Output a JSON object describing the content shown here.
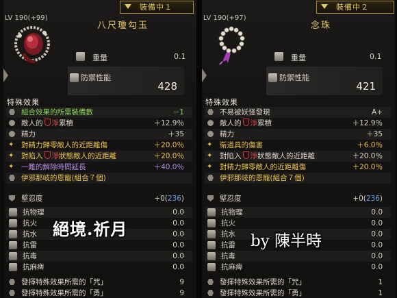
{
  "left": {
    "equip_tab": "裝備中１",
    "level": "LV 190",
    "level_plus": "(+99)",
    "item_name": "八尺瓊勾玉",
    "weight_label": "重量",
    "weight_value": "0.1",
    "defense_label": "防禦性能",
    "defense_value": "428",
    "special_title": "特殊效果",
    "effects": [
      {
        "icon": "hex-icon",
        "pre": "組合效果的所需裝備數",
        "shield": false,
        "post": "",
        "value": "－1",
        "color": "#8cd65b"
      },
      {
        "icon": "dot-icon",
        "pre": "敵人的",
        "shield": true,
        "mid": "淨",
        "post": "累積",
        "value": "＋12.9％",
        "color": "#d9d5cb"
      },
      {
        "icon": "dot-icon",
        "pre": "精力",
        "shield": false,
        "post": "",
        "value": "＋35",
        "color": "#d9d5cb"
      },
      {
        "icon": "star-icon",
        "pre": "對精力歸零敵人的近距離傷",
        "shield": false,
        "post": "",
        "value": "＋20.0％",
        "color": "#e8c24c"
      },
      {
        "icon": "star-icon",
        "pre": "對陷入",
        "shield": true,
        "mid": "淨",
        "post": "狀態敵人的近距離",
        "value": "＋20.0％",
        "color": "#e8c24c"
      },
      {
        "icon": "star-icon",
        "pre": "一難的解除時間延長",
        "shield": false,
        "post": "",
        "value": "＋40.0％",
        "color": "#b48ae0"
      },
      {
        "icon": "hex-icon",
        "pre": "伊邪那岐的恩寵(組合７個)",
        "shield": false,
        "post": "",
        "value": "",
        "color": "#e8c24c"
      }
    ],
    "toughness_label": "堅忍度",
    "toughness_value": "+0(",
    "toughness_value_blue": "236",
    "toughness_close": ")",
    "resistances": [
      {
        "label": "抗物理",
        "value": "0.0"
      },
      {
        "label": "抗火",
        "value": "0.0"
      },
      {
        "label": "抗水",
        "value": "0.0"
      },
      {
        "label": "抗雷",
        "value": "0.0"
      },
      {
        "label": "抗毒",
        "value": "0.0"
      },
      {
        "label": "抗麻痺",
        "value": "0.0"
      }
    ],
    "req1_label": "發揮特殊效果所需的「咒」",
    "req1_value": "9",
    "req2_label": "發揮特殊效果所需的「勇」",
    "req2_value": "9",
    "watermark": "絕境.祈月"
  },
  "right": {
    "equip_tab": "裝備中２",
    "level": "LV 190",
    "level_plus": "(+97)",
    "item_name": "念珠",
    "weight_label": "重量",
    "weight_value": "0.1",
    "defense_label": "防禦性能",
    "defense_value": "421",
    "special_title": "特殊效果",
    "effects": [
      {
        "icon": "hex-icon",
        "pre": "不易被妖怪發現",
        "shield": false,
        "post": "",
        "value": "A+",
        "color": "#d9d5cb"
      },
      {
        "icon": "dot-icon",
        "pre": "敵人的",
        "shield": true,
        "mid": "淨",
        "post": "累積",
        "value": "＋12.9％",
        "color": "#d9d5cb"
      },
      {
        "icon": "dot-icon",
        "pre": "精力",
        "shield": false,
        "post": "",
        "value": "＋35",
        "color": "#d9d5cb"
      },
      {
        "icon": "star-icon",
        "pre": "衛道具的傷害",
        "shield": false,
        "post": "",
        "value": "＋6.0％",
        "color": "#e8c24c"
      },
      {
        "icon": "star-icon",
        "pre": "對陷入",
        "shield": true,
        "mid": "淨",
        "post": "狀態敵人的近距離",
        "value": "＋20.0％",
        "color": "#d9d5cb"
      },
      {
        "icon": "star-icon",
        "pre": "對精力歸零敵人的近距離傷",
        "shield": false,
        "post": "",
        "value": "＋20.0％",
        "color": "#e8c24c"
      },
      {
        "icon": "hex-icon",
        "pre": "伊邪那岐的恩寵(組合７個)",
        "shield": false,
        "post": "",
        "value": "",
        "color": "#e8c24c"
      }
    ],
    "toughness_label": "堅忍度",
    "toughness_value": "+0(",
    "toughness_value_blue": "236",
    "toughness_close": ")",
    "resistances": [
      {
        "label": "抗物理",
        "value": "0.0"
      },
      {
        "label": "抗火",
        "value": "0.0"
      },
      {
        "label": "抗水",
        "value": "0.0"
      },
      {
        "label": "抗雷",
        "value": "0.0"
      },
      {
        "label": "抗毒",
        "value": "0.0"
      },
      {
        "label": "抗麻痺",
        "value": "0.0"
      }
    ],
    "req1_label": "發揮特殊效果所需的「咒」",
    "req1_value": "1",
    "req2_label": "發揮特殊效果所需的「勇」",
    "req2_value": "1",
    "watermark": "by 陳半時"
  }
}
